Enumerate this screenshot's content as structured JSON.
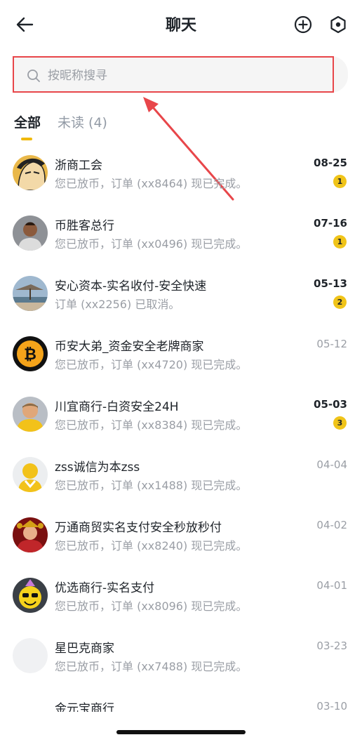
{
  "header": {
    "title": "聊天",
    "back_icon": "arrow-left-icon",
    "add_icon": "plus-circle-icon",
    "settings_icon": "hexagon-settings-icon"
  },
  "search": {
    "placeholder": "按昵称搜寻",
    "value": ""
  },
  "tabs": {
    "all_label": "全部",
    "unread_label": "未读 (4)"
  },
  "colors": {
    "accent": "#f0b90b",
    "badge": "#f0c419",
    "highlight": "#e8464a",
    "text_primary": "#1e2329",
    "text_secondary": "#9a9ea5"
  },
  "chats": [
    {
      "name": "浙商工会",
      "preview": "您已放币，订单 (xx8464) 现已完成。",
      "date": "08-25",
      "unread": "1"
    },
    {
      "name": "币胜客总行",
      "preview": "您已放币，订单 (xx0496) 现已完成。",
      "date": "07-16",
      "unread": "1"
    },
    {
      "name": "安心资本-实名收付-安全快速",
      "preview": "订单 (xx2256) 已取消。",
      "date": "05-13",
      "unread": "2"
    },
    {
      "name": "币安大弟_资金安全老牌商家",
      "preview": "您已放币，订单 (xx4720) 现已完成。",
      "date": "05-12",
      "unread": ""
    },
    {
      "name": "川宜商行-白资安全24H",
      "preview": "您已放币，订单 (xx8384) 现已完成。",
      "date": "05-03",
      "unread": "3"
    },
    {
      "name": "zss诚信为本zss",
      "preview": "您已放币，订单 (xx1488) 现已完成。",
      "date": "04-04",
      "unread": ""
    },
    {
      "name": "万通商贸实名支付安全秒放秒付",
      "preview": "您已放币，订单 (xx8240) 现已完成。",
      "date": "04-02",
      "unread": ""
    },
    {
      "name": "优选商行-实名支付",
      "preview": "您已放币，订单 (xx8096) 现已完成。",
      "date": "04-01",
      "unread": ""
    },
    {
      "name": "星巴克商家",
      "preview": "您已放币，订单 (xx7488) 现已完成。",
      "date": "03-23",
      "unread": ""
    },
    {
      "name": "金元宝商行",
      "preview": "",
      "date": "03-10",
      "unread": ""
    }
  ]
}
